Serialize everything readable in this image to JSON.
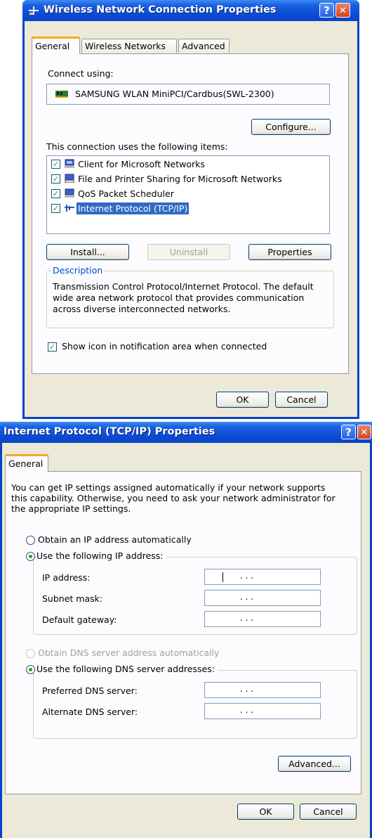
{
  "dialog1": {
    "title": "Wireless Network Connection Properties",
    "help_glyph": "?",
    "close_glyph": "✕",
    "tabs": [
      "General",
      "Wireless Networks",
      "Advanced"
    ],
    "connect_using_label": "Connect using:",
    "adapter_name": "SAMSUNG WLAN MiniPCI/Cardbus(SWL-2300)",
    "configure_label": "Configure...",
    "items_label": "This connection uses the following items:",
    "items": [
      {
        "label": "Client for Microsoft Networks",
        "checked": true,
        "icon": "network-client-icon"
      },
      {
        "label": "File and Printer Sharing for Microsoft Networks",
        "checked": true,
        "icon": "file-printer-sharing-icon"
      },
      {
        "label": "QoS Packet Scheduler",
        "checked": true,
        "icon": "qos-scheduler-icon"
      },
      {
        "label": "Internet Protocol (TCP/IP)",
        "checked": true,
        "selected": true,
        "icon": "protocol-icon"
      }
    ],
    "install_label": "Install...",
    "uninstall_label": "Uninstall",
    "properties_label": "Properties",
    "description_title": "Description",
    "description_lines": [
      "Transmission Control Protocol/Internet Protocol. The default",
      "wide area network protocol that provides communication",
      "across diverse interconnected networks."
    ],
    "show_icon_label": "Show icon in notification area when connected",
    "show_icon_checked": true,
    "ok_label": "OK",
    "cancel_label": "Cancel"
  },
  "dialog2": {
    "title": "Internet Protocol (TCP/IP) Properties",
    "help_glyph": "?",
    "close_glyph": "✕",
    "tab": "General",
    "intro_lines": [
      "You can get IP settings assigned automatically if your network supports",
      "this capability. Otherwise, you need to ask your network administrator for",
      "the appropriate IP settings."
    ],
    "obtain_ip_auto_label": "Obtain an IP address automatically",
    "use_ip_label": "Use the following IP address:",
    "ip_address_label": "IP address:",
    "subnet_mask_label": "Subnet mask:",
    "default_gateway_label": "Default gateway:",
    "obtain_dns_auto_label": "Obtain DNS server address automatically",
    "use_dns_label": "Use the following DNS server addresses:",
    "preferred_dns_label": "Preferred DNS server:",
    "alternate_dns_label": "Alternate DNS server:",
    "ip_placeholder": ".   .   .",
    "advanced_label": "Advanced...",
    "ok_label": "OK",
    "cancel_label": "Cancel"
  },
  "colors": {
    "titlebar": "#0a4bd4",
    "dialog_face": "#ece9d8",
    "selection": "#316ac5",
    "group_title": "#0046d5",
    "check_green": "#21a121"
  }
}
